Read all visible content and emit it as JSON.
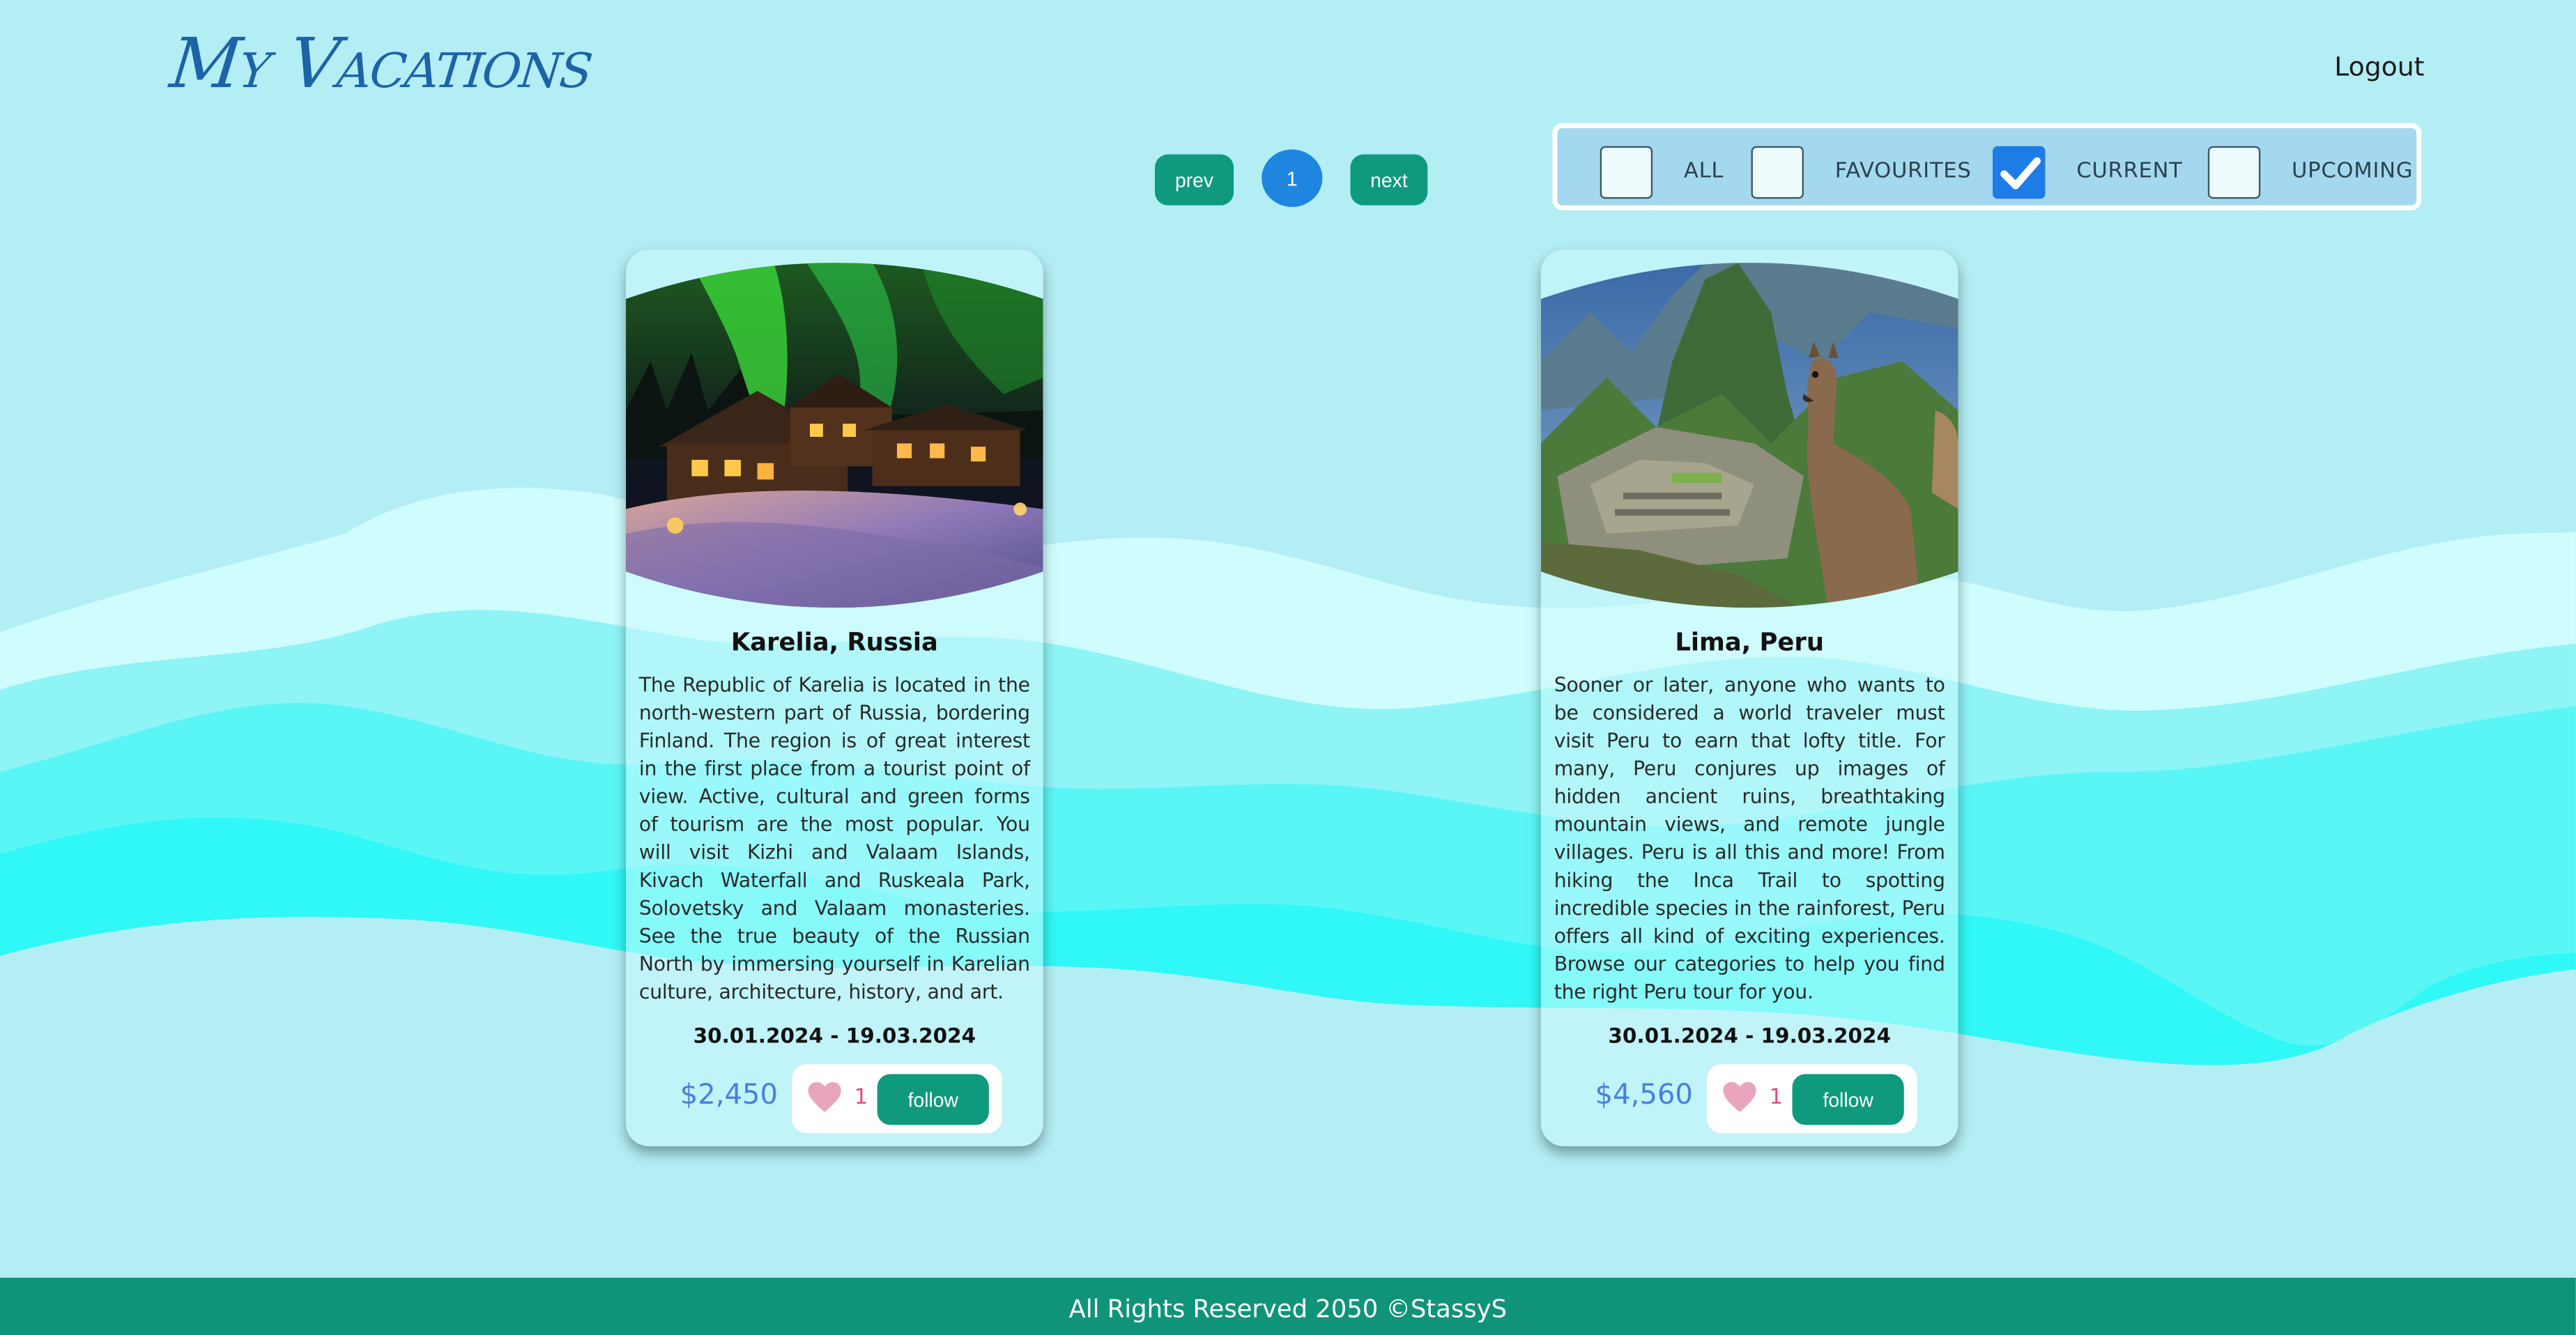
{
  "header": {
    "logo": "My Vacations",
    "logout": "Logout"
  },
  "pagination": {
    "prev": "prev",
    "page": "1",
    "next": "next"
  },
  "filters": [
    {
      "label": "ALL",
      "checked": false
    },
    {
      "label": "FAVOURITES",
      "checked": false
    },
    {
      "label": "CURRENT",
      "checked": true
    },
    {
      "label": "UPCOMING",
      "checked": false
    }
  ],
  "vacations": [
    {
      "title": "Karelia, Russia",
      "description": "The Republic of Karelia is located in the north-western part of Russia, bordering Finland. The region is of great interest in the first place from a tourist point of view. Active, cultural and green forms of tourism are the most popular. You will visit Kizhi and Valaam Islands, Kivach Waterfall and Ruskeala Park, Solovetsky and Valaam monasteries. See the true beauty of the Russian North by immersing yourself in Karelian culture, architecture, history, and art.",
      "dates": "30.01.2024 - 19.03.2024",
      "price": "$2,450",
      "likes": "1",
      "follow": "follow",
      "image": "aurora-cabin-photo"
    },
    {
      "title": "Lima, Peru",
      "description": "Sooner or later, anyone who wants to be considered a world traveler must visit Peru to earn that lofty title. For many, Peru conjures up images of hidden ancient ruins, breathtaking mountain views, and remote jungle villages. Peru is all this and more! From hiking the Inca Trail to spotting incredible species in the rainforest, Peru offers all kind of exciting experiences. Browse our categories to help you find the right Peru tour for you.",
      "dates": "30.01.2024 - 19.03.2024",
      "price": "$4,560",
      "likes": "1",
      "follow": "follow",
      "image": "machu-picchu-llama-photo"
    }
  ],
  "footer": "All Rights Reserved 2050 ©StassyS",
  "colors": {
    "background": "#b2eef4",
    "accent_green": "#0f9a7e",
    "accent_blue": "#1f86e0",
    "price": "#4a7ee0",
    "heart": "#e9a5bd"
  }
}
